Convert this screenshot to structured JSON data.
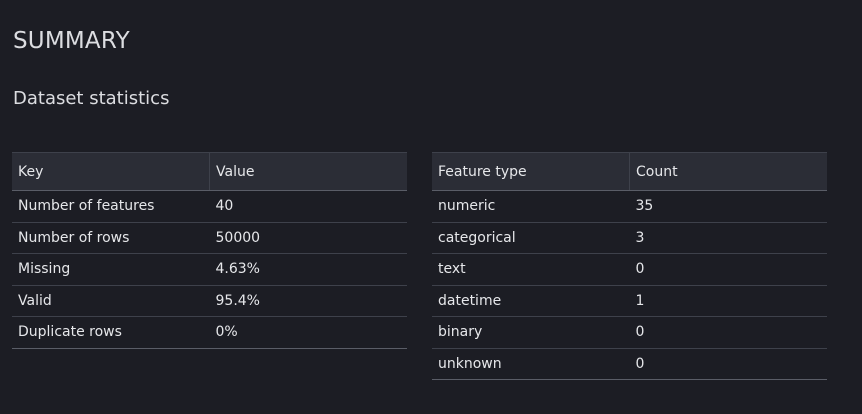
{
  "summary": {
    "title": "SUMMARY",
    "subtitle": "Dataset statistics"
  },
  "stats_table": {
    "headers": [
      "Key",
      "Value"
    ],
    "rows": [
      [
        "Number of features",
        "40"
      ],
      [
        "Number of rows",
        "50000"
      ],
      [
        "Missing",
        "4.63%"
      ],
      [
        "Valid",
        "95.4%"
      ],
      [
        "Duplicate rows",
        "0%"
      ]
    ]
  },
  "types_table": {
    "headers": [
      "Feature type",
      "Count"
    ],
    "rows": [
      [
        "numeric",
        "35"
      ],
      [
        "categorical",
        "3"
      ],
      [
        "text",
        "0"
      ],
      [
        "datetime",
        "1"
      ],
      [
        "binary",
        "0"
      ],
      [
        "unknown",
        "0"
      ]
    ]
  }
}
